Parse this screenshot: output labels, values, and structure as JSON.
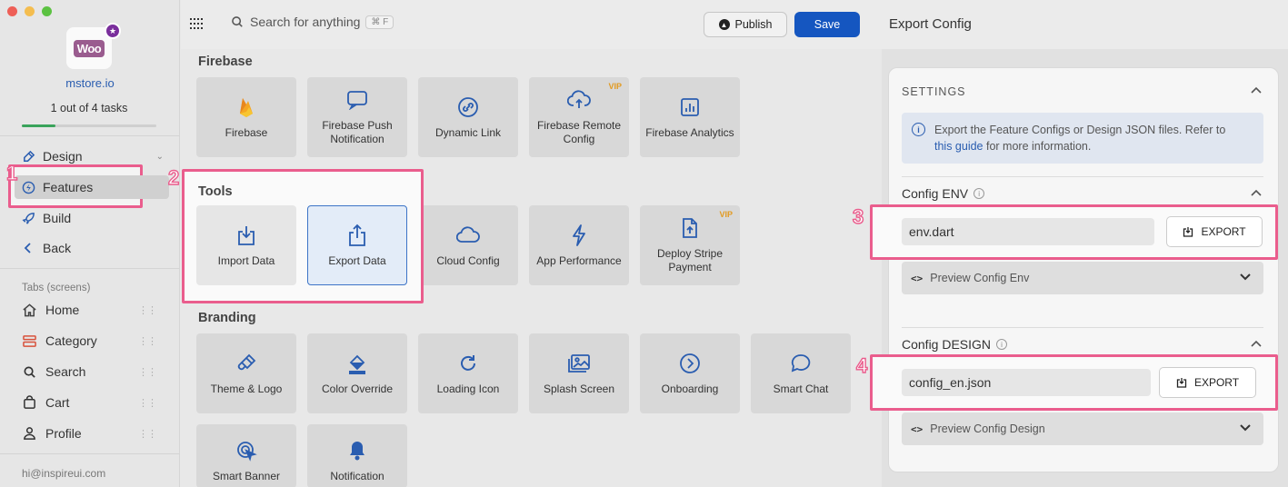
{
  "window": {
    "traffic_colors": [
      "#ee5f57",
      "#f4bd4f",
      "#5cc242"
    ]
  },
  "sidebar": {
    "logo_text": "Woo",
    "site_name": "mstore.io",
    "tasks": "1 out of 4 tasks",
    "progress_fraction": 0.25,
    "nav": [
      {
        "label": "Design",
        "icon": "brush-icon"
      },
      {
        "label": "Features",
        "icon": "bolt-circle-icon"
      },
      {
        "label": "Build",
        "icon": "rocket-icon"
      },
      {
        "label": "Back",
        "icon": "chevron-left-icon"
      }
    ],
    "tabs_label": "Tabs (screens)",
    "tabs": [
      {
        "label": "Home",
        "icon": "home-icon"
      },
      {
        "label": "Category",
        "icon": "category-icon"
      },
      {
        "label": "Search",
        "icon": "search-icon"
      },
      {
        "label": "Cart",
        "icon": "cart-icon"
      },
      {
        "label": "Profile",
        "icon": "person-icon"
      }
    ],
    "email": "hi@inspireui.com"
  },
  "topbar": {
    "search_placeholder": "Search for anything",
    "search_shortcut": "⌘ F",
    "publish": "Publish",
    "save": "Save",
    "panel_title": "Export Config"
  },
  "main": {
    "firebase_title": "Firebase",
    "firebase": [
      {
        "label": "Firebase",
        "icon": "flame-icon"
      },
      {
        "label": "Firebase Push Notification",
        "icon": "chat-bubble-icon"
      },
      {
        "label": "Dynamic Link",
        "icon": "link-icon"
      },
      {
        "label": "Firebase Remote Config",
        "icon": "cloud-upload-icon",
        "badge": "VIP"
      },
      {
        "label": "Firebase Analytics",
        "icon": "bar-chart-icon"
      }
    ],
    "tools_title": "Tools",
    "tools": [
      {
        "label": "Import Data",
        "icon": "download-icon"
      },
      {
        "label": "Export Data",
        "icon": "share-icon"
      }
    ],
    "tools_extra": [
      {
        "label": "Cloud Config",
        "icon": "cloud-icon"
      },
      {
        "label": "App Performance",
        "icon": "lightning-icon"
      },
      {
        "label": "Deploy Stripe Payment",
        "icon": "file-upload-icon",
        "badge": "VIP"
      }
    ],
    "branding_title": "Branding",
    "branding": [
      {
        "label": "Theme & Logo",
        "icon": "paintbrush-icon"
      },
      {
        "label": "Color Override",
        "icon": "paint-bucket-icon"
      },
      {
        "label": "Loading Icon",
        "icon": "refresh-icon"
      },
      {
        "label": "Splash Screen",
        "icon": "image-icon"
      },
      {
        "label": "Onboarding",
        "icon": "arrow-circle-icon"
      },
      {
        "label": "Smart Chat",
        "icon": "chat-bubble-icon"
      },
      {
        "label": "Smart Banner",
        "icon": "target-cursor-icon"
      },
      {
        "label": "Notification",
        "icon": "bell-icon"
      }
    ]
  },
  "settings": {
    "title": "SETTINGS",
    "info_prefix": "Export the Feature Configs or Design JSON files. Refer to",
    "info_link": "this guide",
    "info_suffix": "for more information.",
    "env": {
      "title": "Config ENV",
      "file": "env.dart",
      "export": "EXPORT",
      "preview": "Preview Config Env"
    },
    "design": {
      "title": "Config DESIGN",
      "file": "config_en.json",
      "export": "EXPORT",
      "preview": "Preview Config Design"
    }
  },
  "annotations": [
    "1",
    "2",
    "3",
    "4"
  ],
  "colors": {
    "accent": "#1556c0",
    "highlight": "#ea5d8d",
    "vip": "#e29a20"
  }
}
